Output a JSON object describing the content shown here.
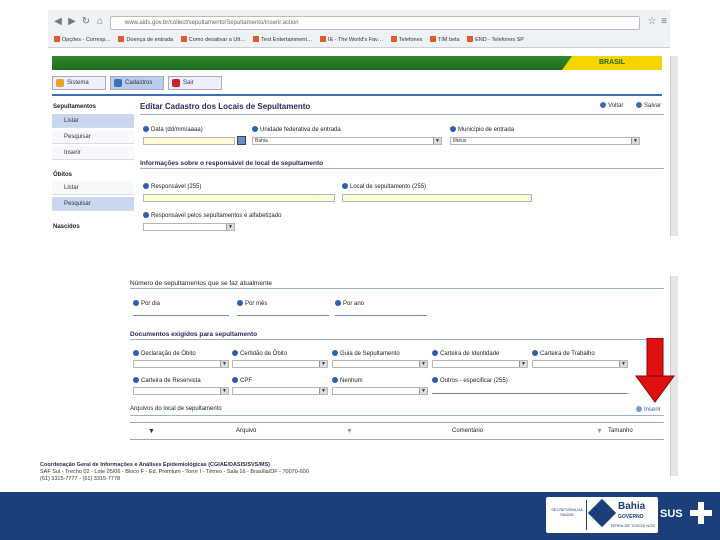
{
  "browser": {
    "address": "www.aids.gov.br/collect/sepultamento/Sepultamento/inserir.action",
    "bookmarks": [
      "Opções - Corresp…",
      "Doença de entrada",
      "Como desativar a Ult…",
      "Test Entertainment…",
      "IE - The World's Fav…",
      "Telefones",
      "TIM beta",
      "END - Telefones SP"
    ]
  },
  "gov": {
    "brasil": "BRASIL"
  },
  "tabs": [
    {
      "label": "Sistema"
    },
    {
      "label": "Cadastros"
    },
    {
      "label": "Sair"
    }
  ],
  "sidebar": {
    "sepultamentos": "Sepultamentos",
    "sep_items": [
      "Listar",
      "Pesquisar",
      "Inserir"
    ],
    "obitos": "Óbitos",
    "obito_items": [
      "Listar",
      "Pesquisar"
    ],
    "nascidos": "Nascidos"
  },
  "page": {
    "title": "Editar Cadastro dos Locais de Sepultamento",
    "voltar": "Voltar",
    "salvar": "Salvar"
  },
  "form": {
    "data_label": "Data (dd/mm/aaaa)",
    "uf_label": "Unidade federativa de entrada",
    "uf_value": "Bahia",
    "municipio_label": "Município de entrada",
    "municipio_value": "Ilhéus",
    "section_responsavel": "Informações sobre o responsável de local de sepultamento",
    "responsavel_label": "Responsável (255)",
    "local_label": "Local de sepultamento (255)",
    "alfabetizado_label": "Responsável pelos sepultamentos é alfabetizado",
    "numero_label": "Número de sepultamentos que se faz atualmente",
    "por_dia": "Por dia",
    "por_mes": "Por mês",
    "por_ano": "Por ano",
    "section_documentos": "Documentos exigidos para sepultamento",
    "docs_row1": [
      "Declaração de Óbito",
      "Certidão de Óbito",
      "Guia de Sepultamento",
      "Carteira de Identidade",
      "Carteira de Trabalho"
    ],
    "docs_row2": [
      "Carteira de Reservista",
      "CPF",
      "Nenhum",
      "Outros - especificar (255)"
    ],
    "arquivos_label": "Arquivos do local de sepultamento",
    "inserir": "Inserir",
    "col_arquivo": "Arquivo",
    "col_comentario": "Comentário",
    "col_tamanho": "Tamanho"
  },
  "footer": {
    "line1": "Coordenação Geral de Informações e Análises Epidemiológicas (CGIAE/DASIS/SVS/MS)",
    "line2": "SAF Sul - Trecho 02 - Lote 05/06 - Bloco F - Ed. Premium - Torre I - Térreo - Sala 16 - Brasília/DF - 70070-600",
    "line3": "(61) 3315-7777 - (61) 3315-7778"
  },
  "logos": {
    "secretaria": "SECRETARIA DA SAÚDE",
    "bahia": "Bahia",
    "governo": "GOVERNO",
    "slogan": "TERRA DE TODOS NÓS",
    "sus": "SUS"
  },
  "colors": {
    "accent": "#3d6fb5",
    "bottom": "#1a3f7a",
    "arrow": "#e11010",
    "yellow_field": "#fffbd6"
  }
}
